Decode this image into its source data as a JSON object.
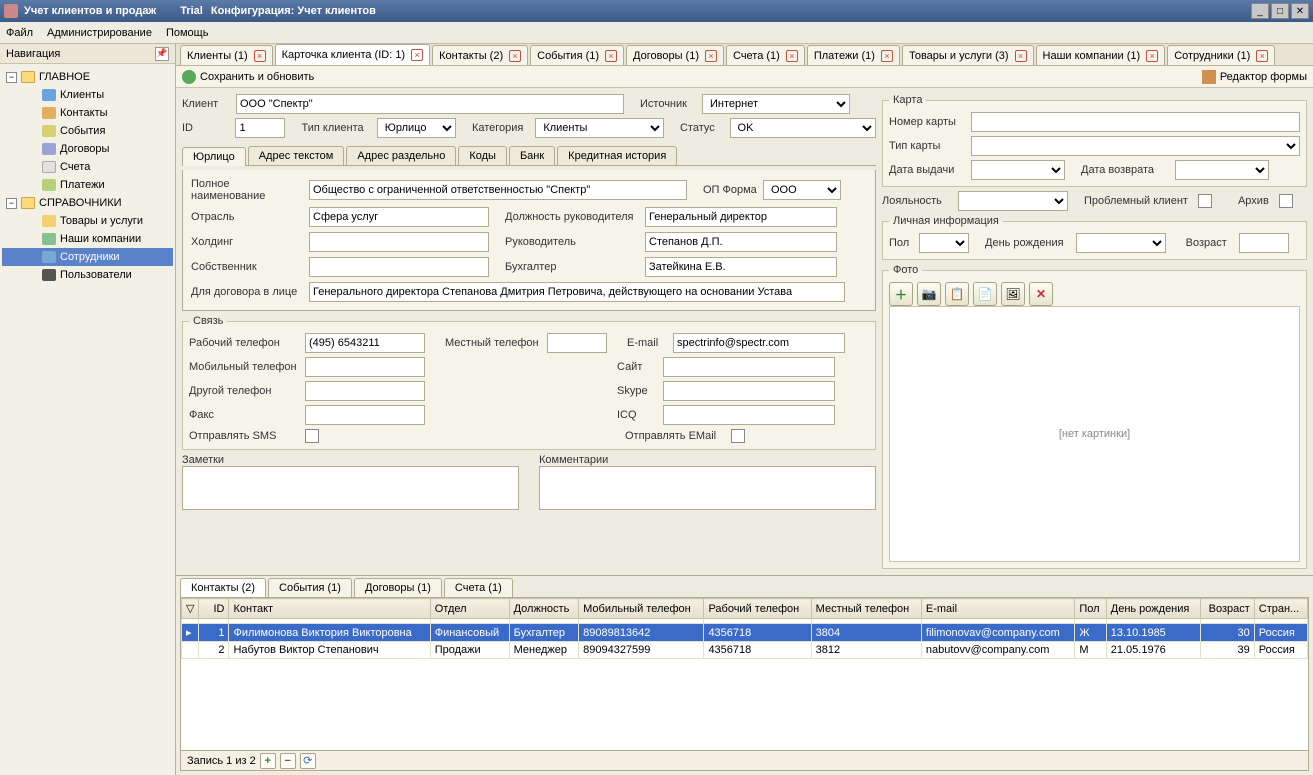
{
  "titlebar": {
    "app": "Учет клиентов и продаж",
    "trial": "Trial",
    "config": "Конфигурация: Учет клиентов"
  },
  "menu": {
    "file": "Файл",
    "admin": "Администрирование",
    "help": "Помощь"
  },
  "nav": {
    "header": "Навигация",
    "main_group": "ГЛАВНОЕ",
    "clients": "Клиенты",
    "contacts": "Контакты",
    "events": "События",
    "contracts": "Договоры",
    "accounts": "Счета",
    "payments": "Платежи",
    "ref_group": "СПРАВОЧНИКИ",
    "goods": "Товары и услуги",
    "companies": "Наши компании",
    "employees": "Сотрудники",
    "users": "Пользователи"
  },
  "tabs": [
    "Клиенты (1)",
    "Карточка клиента (ID: 1)",
    "Контакты (2)",
    "События (1)",
    "Договоры (1)",
    "Счета (1)",
    "Платежи (1)",
    "Товары и услуги (3)",
    "Наши компании (1)",
    "Сотрудники (1)"
  ],
  "toolbar": {
    "save": "Сохранить и обновить",
    "editor": "Редактор формы"
  },
  "form": {
    "client_label": "Клиент",
    "client": "ООО \"Спектр\"",
    "source_label": "Источник",
    "source": "Интернет",
    "id_label": "ID",
    "id": "1",
    "type_label": "Тип клиента",
    "type": "Юрлицо",
    "category_label": "Категория",
    "category": "Клиенты",
    "status_label": "Статус",
    "status": "OK",
    "subtabs": [
      "Юрлицо",
      "Адрес текстом",
      "Адрес раздельно",
      "Коды",
      "Банк",
      "Кредитная история"
    ],
    "fullname_label": "Полное наименование",
    "fullname": "Общество с ограниченной ответственностью \"Спектр\"",
    "opform_label": "ОП Форма",
    "opform": "ООО",
    "industry_label": "Отрасль",
    "industry": "Сфера услуг",
    "head_pos_label": "Должность руководителя",
    "head_pos": "Генеральный директор",
    "holding_label": "Холдинг",
    "holding": "",
    "head_label": "Руководитель",
    "head": "Степанов Д.П.",
    "owner_label": "Собственник",
    "owner": "",
    "accountant_label": "Бухгалтер",
    "accountant": "Затейкина Е.В.",
    "contract_person_label": "Для договора в лице",
    "contract_person": "Генерального директора Степанова Дмитрия Петровича, действующего на основании Устава",
    "contact_group": "Связь",
    "work_phone_label": "Рабочий телефон",
    "work_phone": "(495) 6543211",
    "local_phone_label": "Местный телефон",
    "local_phone": "",
    "email_label": "E-mail",
    "email": "spectrinfo@spectr.com",
    "mobile_label": "Мобильный телефон",
    "mobile": "",
    "site_label": "Сайт",
    "site": "",
    "other_phone_label": "Другой телефон",
    "other_phone": "",
    "skype_label": "Skype",
    "skype": "",
    "fax_label": "Факс",
    "fax": "",
    "icq_label": "ICQ",
    "icq": "",
    "send_sms_label": "Отправлять SMS",
    "send_email_label": "Отправлять EMail",
    "notes_label": "Заметки",
    "comments_label": "Комментарии"
  },
  "card": {
    "group": "Карта",
    "number_label": "Номер карты",
    "type_label": "Тип карты",
    "issue_label": "Дата выдачи",
    "return_label": "Дата возврата",
    "loyalty_label": "Лояльность",
    "problem_label": "Проблемный клиент",
    "archive_label": "Архив",
    "personal_group": "Личная информация",
    "sex_label": "Пол",
    "birthday_label": "День рождения",
    "age_label": "Возраст",
    "photo_label": "Фото",
    "no_image": "[нет картинки]"
  },
  "lower": {
    "tabs": [
      "Контакты (2)",
      "События (1)",
      "Договоры (1)",
      "Счета (1)"
    ],
    "columns": [
      "",
      "ID",
      "Контакт",
      "Отдел",
      "Должность",
      "Мобильный телефон",
      "Рабочий телефон",
      "Местный телефон",
      "E-mail",
      "Пол",
      "День рождения",
      "Возраст",
      "Стран..."
    ],
    "rows": [
      {
        "id": "1",
        "contact": "Филимонова Виктория Викторовна",
        "dept": "Финансовый",
        "pos": "Бухгалтер",
        "mobile": "89089813642",
        "work": "4356718",
        "local": "3804",
        "email": "filimonovav@company.com",
        "sex": "Ж",
        "birth": "13.10.1985",
        "age": "30",
        "country": "Россия"
      },
      {
        "id": "2",
        "contact": "Набутов Виктор Степанович",
        "dept": "Продажи",
        "pos": "Менеджер",
        "mobile": "89094327599",
        "work": "4356718",
        "local": "3812",
        "email": "nabutovv@company.com",
        "sex": "М",
        "birth": "21.05.1976",
        "age": "39",
        "country": "Россия"
      }
    ],
    "footer": "Запись 1 из 2"
  }
}
